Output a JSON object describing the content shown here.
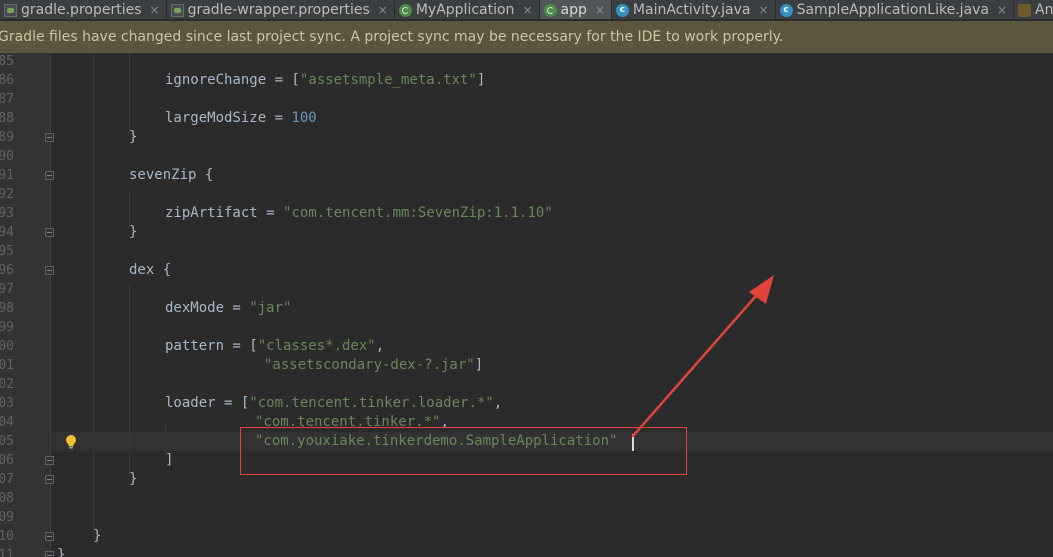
{
  "tabs": [
    {
      "label": "gradle.properties",
      "icon": "gradle-file-icon",
      "active": false
    },
    {
      "label": "gradle-wrapper.properties",
      "icon": "gradle-file-icon",
      "active": false
    },
    {
      "label": "MyApplication",
      "icon": "gradle-module-icon",
      "active": false
    },
    {
      "label": "app",
      "icon": "gradle-module-icon",
      "active": true
    },
    {
      "label": "MainActivity.java",
      "icon": "java-class-icon",
      "active": false
    },
    {
      "label": "SampleApplicationLike.java",
      "icon": "java-class-icon",
      "active": false
    },
    {
      "label": "AndroidManifest.xml",
      "icon": "xml-file-icon",
      "active": false
    }
  ],
  "close_glyph": "×",
  "class_glyph": "c",
  "banner": {
    "message": "Gradle files have changed since last project sync. A project sync may be necessary for the IDE to work properly."
  },
  "gutter": {
    "line_numbers": [
      "85",
      "86",
      "87",
      "88",
      "89",
      "90",
      "91",
      "92",
      "93",
      "94",
      "95",
      "96",
      "97",
      "98",
      "99",
      "100",
      "101",
      "102",
      "103",
      "104",
      "105",
      "106",
      "107",
      "108",
      "109",
      "110",
      "111"
    ]
  },
  "code": {
    "ignore_key": "ignoreChange = [",
    "ignore_val": "\"assetsmple_meta.txt\"",
    "ignore_end": "]",
    "largemod_key": "largeModSize = ",
    "largemod_val": "100",
    "close_brace": "}",
    "sevenzip_open": "sevenZip {",
    "zip_key": "zipArtifact = ",
    "zip_val": "\"com.tencent.mm:SevenZip:1.1.10\"",
    "dex_open": "dex {",
    "dexmode_key": "dexMode = ",
    "dexmode_val": "\"jar\"",
    "pattern_key": "pattern = [",
    "pattern_val1": "\"classes*.dex\"",
    "pattern_comma": ",",
    "pattern_val2": "\"assetscondary-dex-?.jar\"",
    "pattern_end": "]",
    "loader_key": "loader = [",
    "loader_val1": "\"com.tencent.tinker.loader.*\"",
    "loader_comma": ",",
    "loader_val2": "\"com.tencent.tinker.*\"",
    "loader_val3": "\"com.youxiake.tinkerdemo.SampleApplication\"",
    "loader_end": "]"
  },
  "colors": {
    "annotation": "#e0443a",
    "string": "#6a8759",
    "number": "#6897bb",
    "banner_bg": "#5a573c"
  },
  "annotation": {
    "highlight_box": "red-rectangle",
    "pointer": "red-arrow"
  }
}
